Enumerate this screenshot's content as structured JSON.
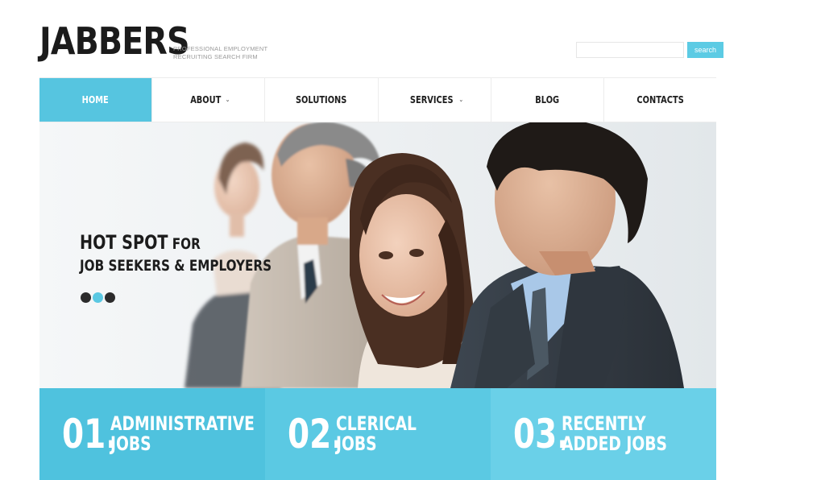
{
  "header": {
    "logo": "JABBERS",
    "tagline": [
      "PROFESSIONAL EMPLOYMENT",
      "RECRUITING SEARCH FIRM"
    ],
    "search": {
      "placeholder": "",
      "value": "",
      "button_label": "search"
    }
  },
  "nav": {
    "items": [
      {
        "label": "HOME",
        "active": true,
        "dropdown": false
      },
      {
        "label": "ABOUT",
        "active": false,
        "dropdown": true
      },
      {
        "label": "SOLUTIONS",
        "active": false,
        "dropdown": false
      },
      {
        "label": "SERVICES",
        "active": false,
        "dropdown": true
      },
      {
        "label": "BLOG",
        "active": false,
        "dropdown": false
      },
      {
        "label": "CONTACTS",
        "active": false,
        "dropdown": false
      }
    ],
    "dropdown_icon": "chevron-down-icon"
  },
  "hero": {
    "title_big": "HOT SPOT",
    "title_small": " FOR",
    "subtitle": "JOB SEEKERS & EMPLOYERS",
    "slides": 3,
    "active_slide": 2,
    "image": "business-people-in-a-row-photo"
  },
  "features": [
    {
      "number": "01.",
      "line1": "ADMINISTRATIVE",
      "line2": "JOBS"
    },
    {
      "number": "02.",
      "line1": "CLERICAL",
      "line2": "JOBS"
    },
    {
      "number": "03.",
      "line1": "RECENTLY",
      "line2": "ADDED JOBS"
    }
  ],
  "colors": {
    "accent": "#56c5e0",
    "logo": "#1b1b1b",
    "nav_text": "#1e1e1e",
    "feature_1": "#4fc2de",
    "feature_2": "#5bc9e3",
    "feature_3": "#6ad0e8"
  }
}
